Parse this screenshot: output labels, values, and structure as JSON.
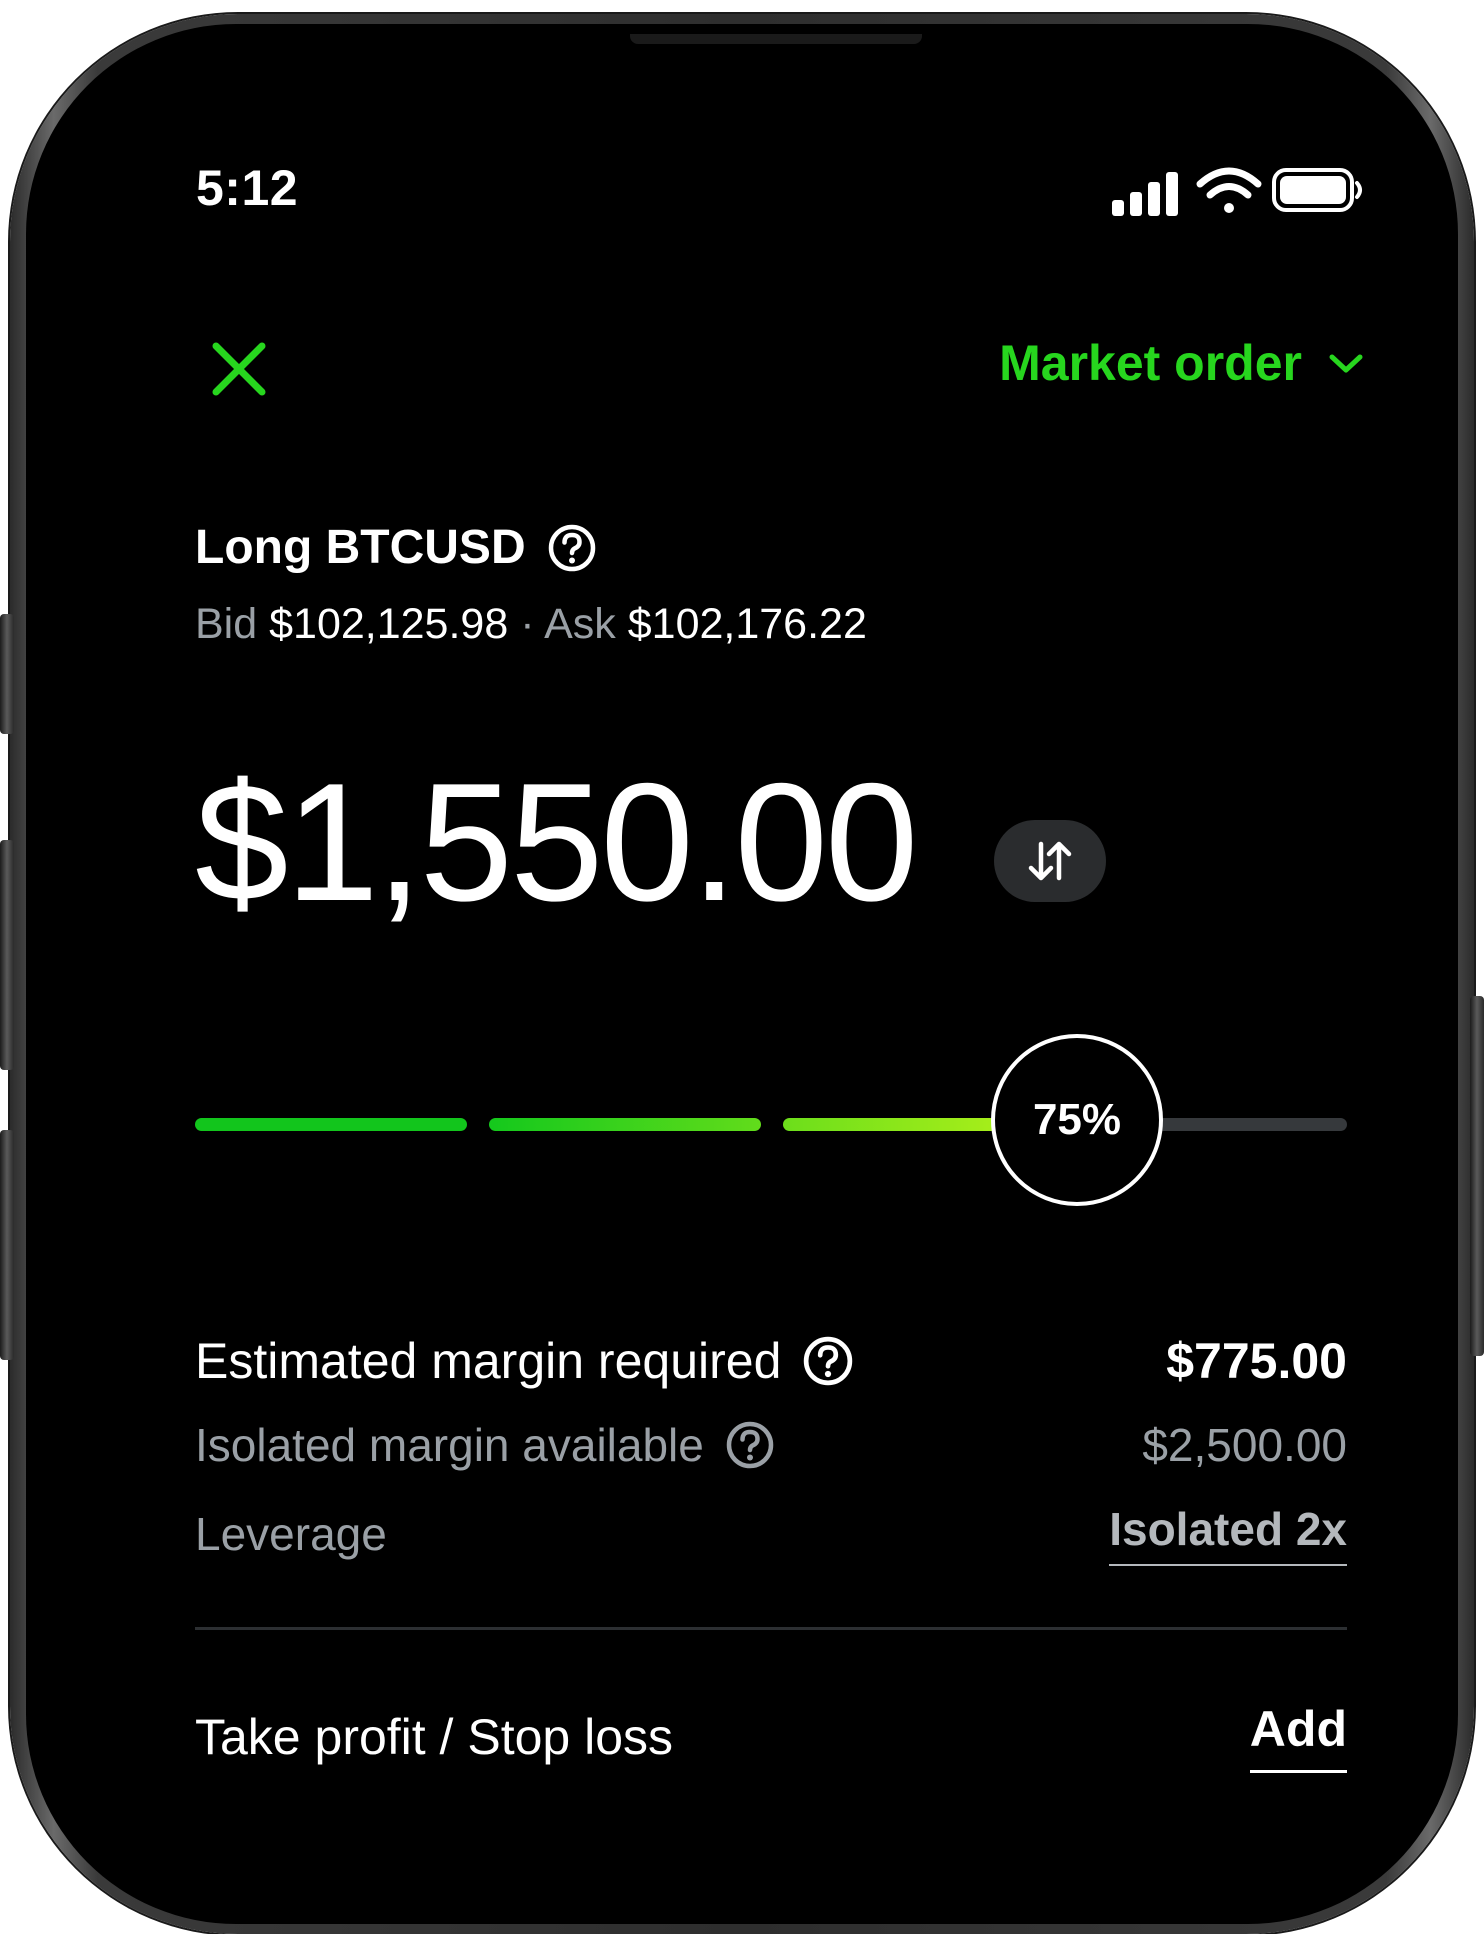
{
  "status_bar": {
    "time": "5:12",
    "icons": [
      "signal-icon",
      "wifi-icon",
      "battery-icon"
    ]
  },
  "header": {
    "close_icon": "close-icon",
    "order_type_label": "Market order",
    "order_type_icon": "chevron-down-icon"
  },
  "instrument": {
    "title": "Long BTCUSD",
    "bid_label": "Bid",
    "bid_value": "$102,125.98",
    "separator": "·",
    "ask_label": "Ask",
    "ask_value": "$102,176.22"
  },
  "amount": {
    "value": "$1,550.00",
    "swap_icon": "swap-arrows-icon"
  },
  "slider": {
    "percent_label": "75%",
    "value_fraction": 0.75
  },
  "details": {
    "margin_required_label": "Estimated margin required",
    "margin_required_value": "$775.00",
    "isolated_available_label": "Isolated margin available",
    "isolated_available_value": "$2,500.00",
    "leverage_label": "Leverage",
    "leverage_value": "Isolated 2x"
  },
  "tpsl": {
    "label": "Take profit / Stop loss",
    "action": "Add"
  },
  "colors": {
    "accent": "#27d61e",
    "text_secondary": "#9aa0a6",
    "slider_green": "#12c51c",
    "slider_lime": "#a4ec1a",
    "slider_track": "#36393c"
  }
}
